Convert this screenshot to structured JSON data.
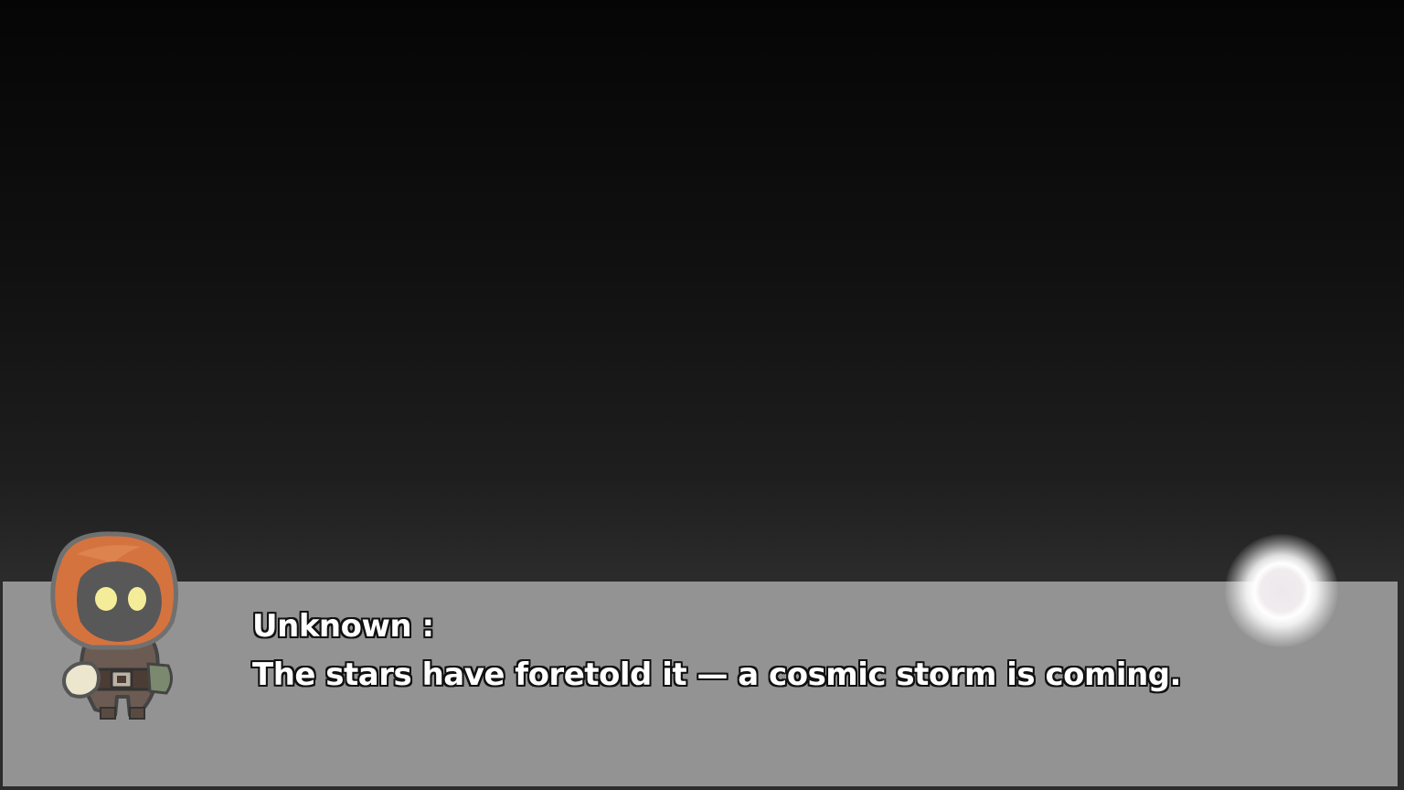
{
  "dialogue": {
    "speaker": "Unknown :",
    "text": "The stars have foretold it — a cosmic storm is coming."
  },
  "portrait": {
    "character": "hooded-figure",
    "hood_color": "#d5733f",
    "face_color": "#585858",
    "eye_color": "#f5ec9a"
  },
  "colors": {
    "dialogue_box": "#939393",
    "text": "#ffffff",
    "text_outline": "#111111"
  }
}
